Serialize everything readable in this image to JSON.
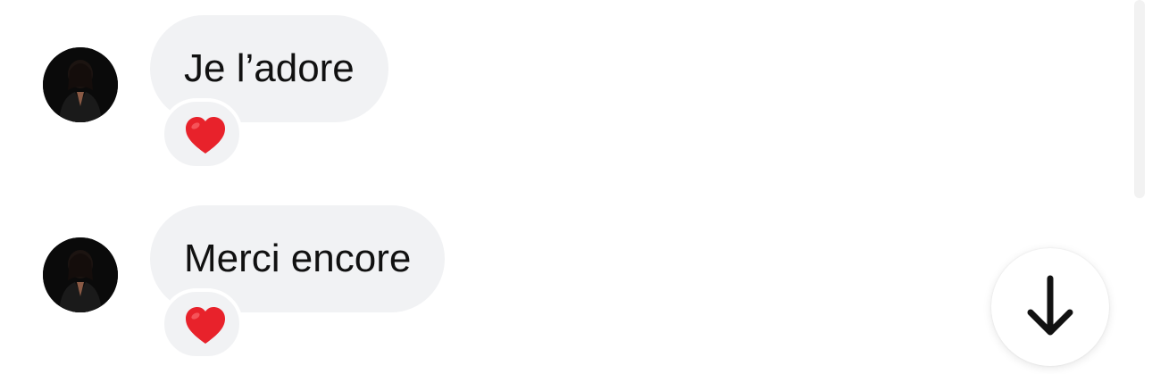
{
  "messages": [
    {
      "text": "Je l’adore",
      "reaction": "❤️",
      "avatar_icon": "user-avatar-photo"
    },
    {
      "text": "Merci encore",
      "reaction": "❤️",
      "avatar_icon": "user-avatar-photo"
    }
  ],
  "controls": {
    "scroll_down_icon": "arrow-down-icon"
  },
  "colors": {
    "bubble_bg": "#f1f2f4",
    "text": "#111111",
    "heart": "#e8222b",
    "background": "#ffffff"
  }
}
